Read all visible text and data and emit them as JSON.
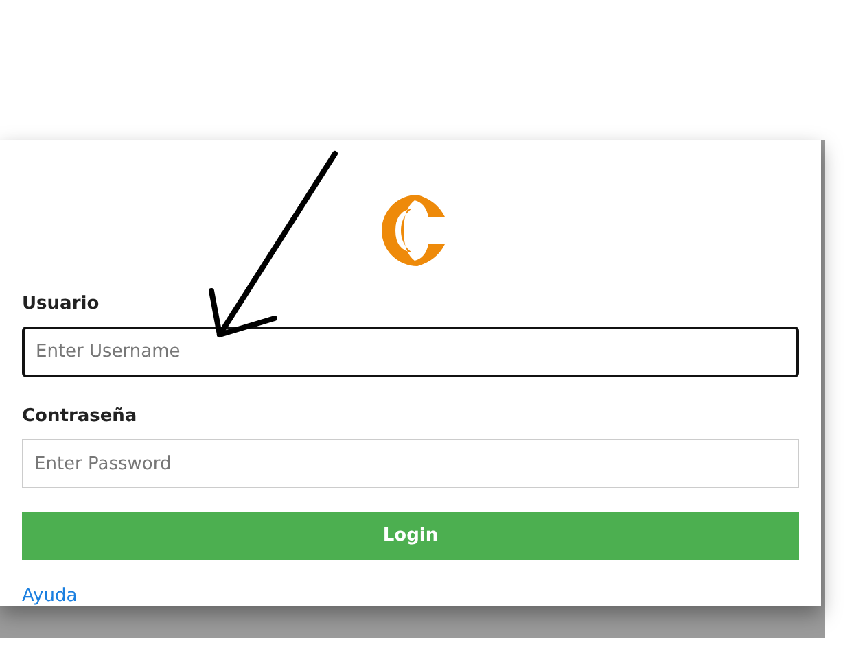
{
  "fields": [
    {
      "label": "Usuario",
      "placeholder": "Enter Username",
      "focused": true
    },
    {
      "label": "Contraseña",
      "placeholder": "Enter Password",
      "focused": false
    }
  ],
  "login_button": "Login",
  "help_link": "Ayuda"
}
